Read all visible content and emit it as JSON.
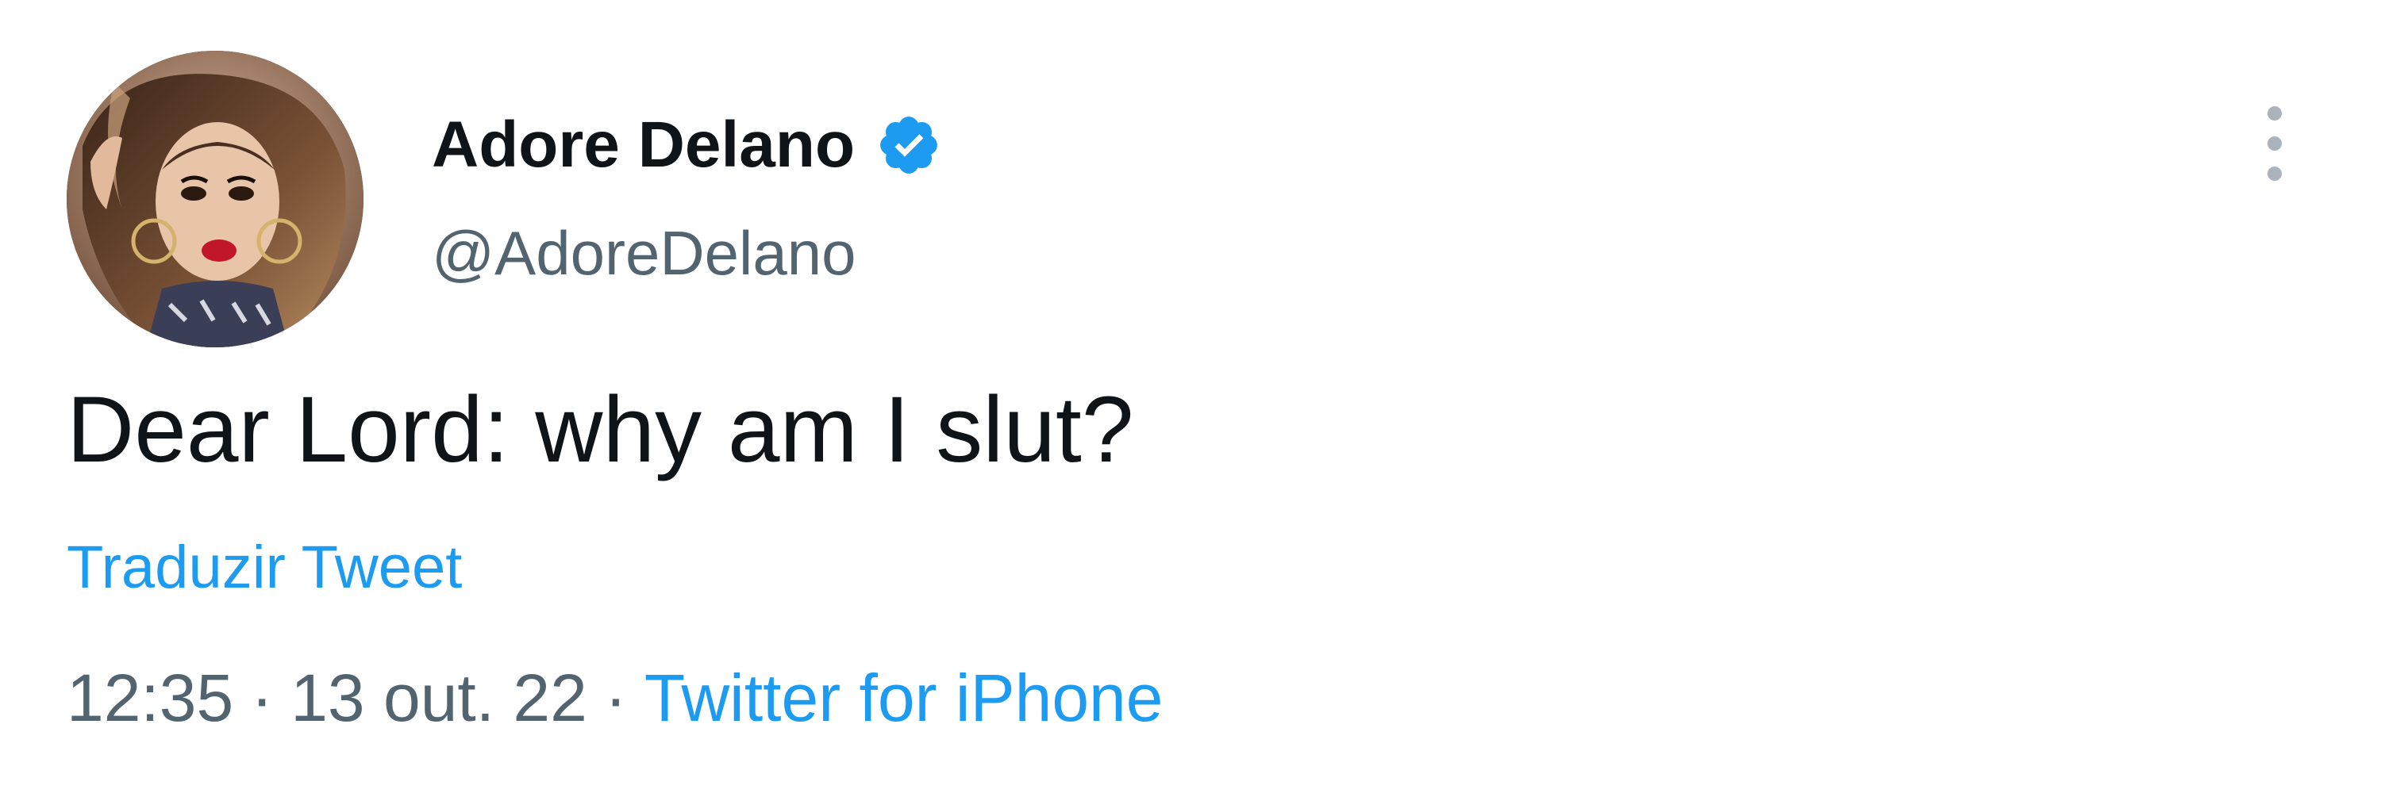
{
  "user": {
    "display_name": "Adore Delano",
    "handle": "@AdoreDelano",
    "verified_icon": "verified-badge-icon",
    "avatar_icon": "profile-photo"
  },
  "tweet": {
    "text": "Dear Lord: why am I slut?",
    "translate_label": "Traduzir Tweet",
    "time": "12:35",
    "date": "13 out. 22",
    "separator": "·",
    "source": "Twitter for iPhone"
  },
  "menu": {
    "icon": "more-vertical-icon"
  },
  "colors": {
    "accent": "#1d9bf0",
    "secondary_text": "#536471",
    "primary_text": "#0f1419"
  }
}
